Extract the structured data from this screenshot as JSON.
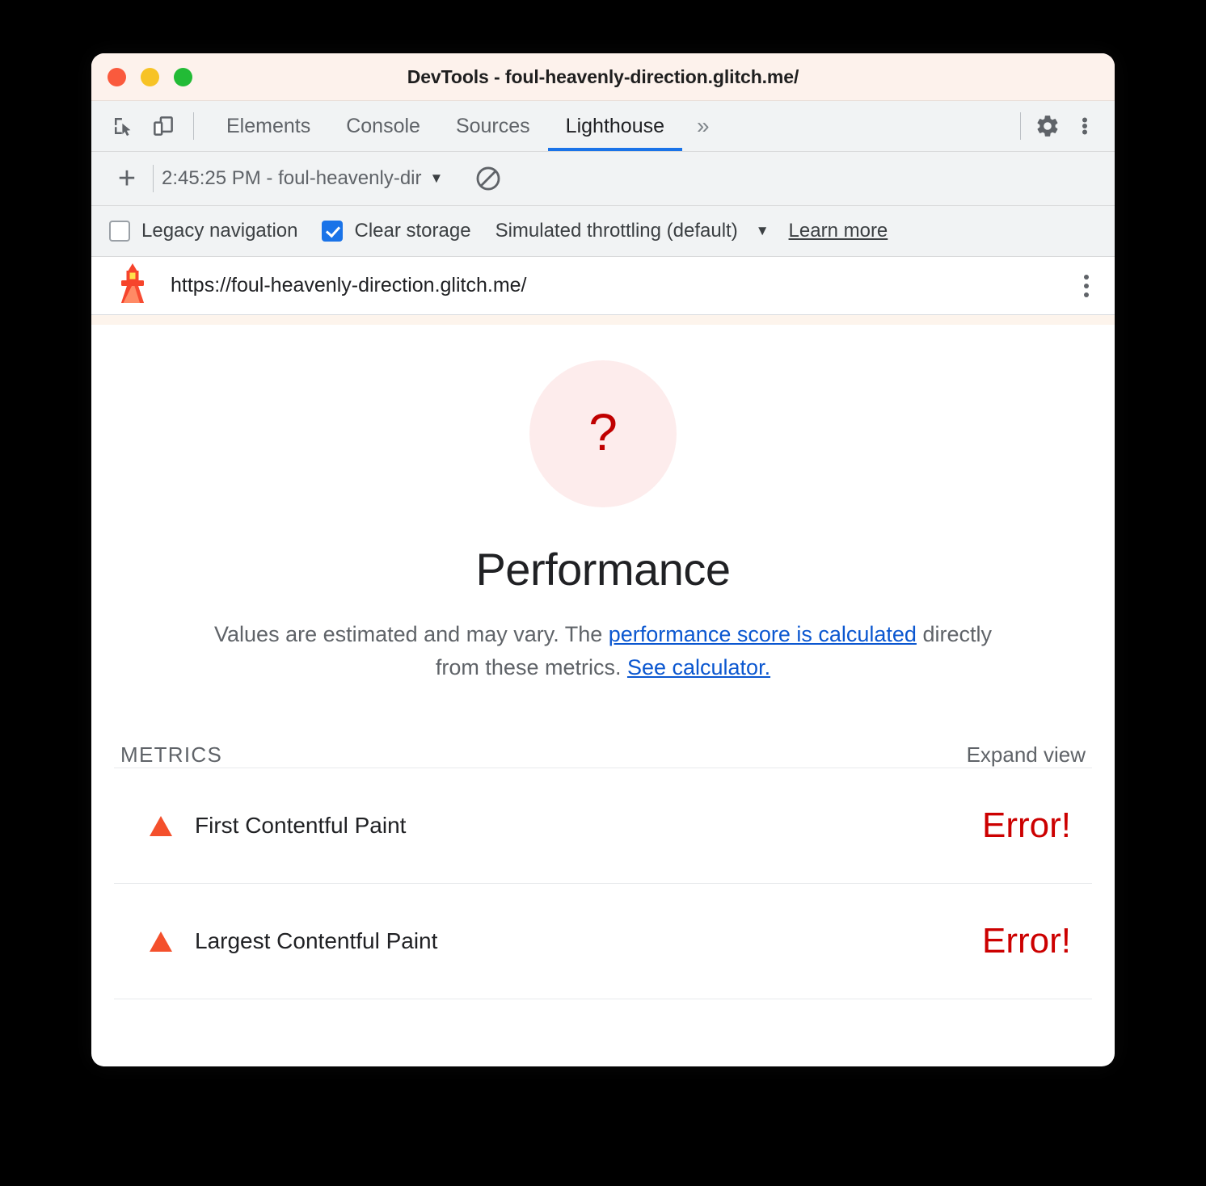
{
  "window": {
    "title": "DevTools - foul-heavenly-direction.glitch.me/",
    "controls": [
      {
        "name": "close",
        "color": "#fa5a3d"
      },
      {
        "name": "minimize",
        "color": "#f7c325"
      },
      {
        "name": "maximize",
        "color": "#22bb36"
      }
    ]
  },
  "devtools": {
    "left_icons": [
      {
        "name": "inspect-element-icon"
      },
      {
        "name": "device-toolbar-icon"
      }
    ],
    "tabs": [
      {
        "label": "Elements",
        "active": false
      },
      {
        "label": "Console",
        "active": false
      },
      {
        "label": "Sources",
        "active": false
      },
      {
        "label": "Lighthouse",
        "active": true
      }
    ],
    "overflow_label": "»",
    "right_icons": [
      {
        "name": "settings-gear-icon"
      },
      {
        "name": "more-options-icon"
      }
    ],
    "active_tab_accent": "#1a73e8"
  },
  "lighthouse_toolbar": {
    "new_report_label": "+",
    "run_selector_value": "2:45:25 PM - foul-heavenly-dir",
    "run_selector_caret": "▼",
    "clear_icon": "clear-all-icon"
  },
  "settings": {
    "legacy_navigation": {
      "label": "Legacy navigation",
      "checked": false
    },
    "clear_storage": {
      "label": "Clear storage",
      "checked": true
    },
    "throttling": {
      "label": "Simulated throttling (default)",
      "caret": "▼"
    },
    "learn_more": "Learn more",
    "checkbox_accent": "#1a73e8"
  },
  "report_header": {
    "logo": "lighthouse-logo-icon",
    "url": "https://foul-heavenly-direction.glitch.me/",
    "menu_icon": "report-options-icon"
  },
  "category": {
    "gauge_symbol": "?",
    "gauge_bg_color": "#fdecec",
    "gauge_symbol_color": "#c00000",
    "title": "Performance",
    "description_part1": "Values are estimated and may vary. The ",
    "description_link1": "performance score is calculated",
    "description_part2": " directly from these metrics. ",
    "description_link2": "See calculator.",
    "link_color": "#0b57d0"
  },
  "metrics": {
    "section_title": "METRICS",
    "expand_view_label": "Expand view",
    "error_color": "#cc0000",
    "marker_color": "#f4502c",
    "rows": [
      {
        "icon": "fail-triangle-icon",
        "name": "First Contentful Paint",
        "value": "Error!"
      },
      {
        "icon": "fail-triangle-icon",
        "name": "Largest Contentful Paint",
        "value": "Error!"
      }
    ]
  }
}
